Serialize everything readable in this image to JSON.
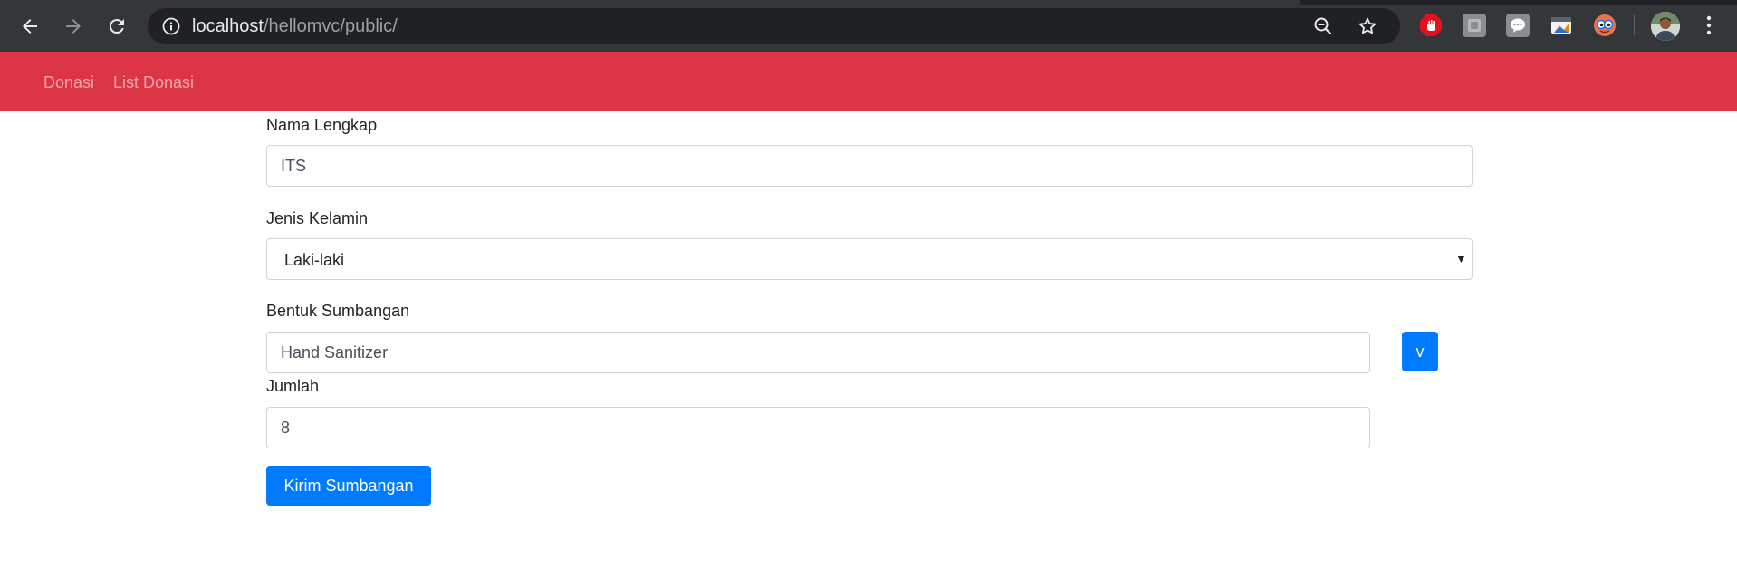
{
  "browser": {
    "url_host": "localhost",
    "url_path": "/hellomvc/public/",
    "icons": {
      "back": "back-arrow-icon",
      "forward": "forward-arrow-icon",
      "reload": "reload-icon",
      "site_info": "info-icon",
      "zoom": "zoom-out-icon",
      "bookmark": "star-icon",
      "menu": "three-dots-menu-icon"
    },
    "extensions": [
      "adblock-extension-icon",
      "gray-extension-icon",
      "chat-extension-icon",
      "window-extension-icon",
      "eyes-extension-icon"
    ]
  },
  "navbar": {
    "color": "#dc3545",
    "links": [
      "Donasi",
      "List Donasi"
    ]
  },
  "form": {
    "nama_label": "Nama Lengkap",
    "nama_value": "ITS",
    "gender_label": "Jenis Kelamin",
    "gender_value": "Laki-laki",
    "gender_arrow": "▼",
    "bentuk_label": "Bentuk Sumbangan",
    "bentuk_value": "Hand Sanitizer",
    "bentuk_button": "v",
    "jumlah_label": "Jumlah",
    "jumlah_value": "8",
    "submit_label": "Kirim Sumbangan",
    "accent_color": "#007bff"
  }
}
